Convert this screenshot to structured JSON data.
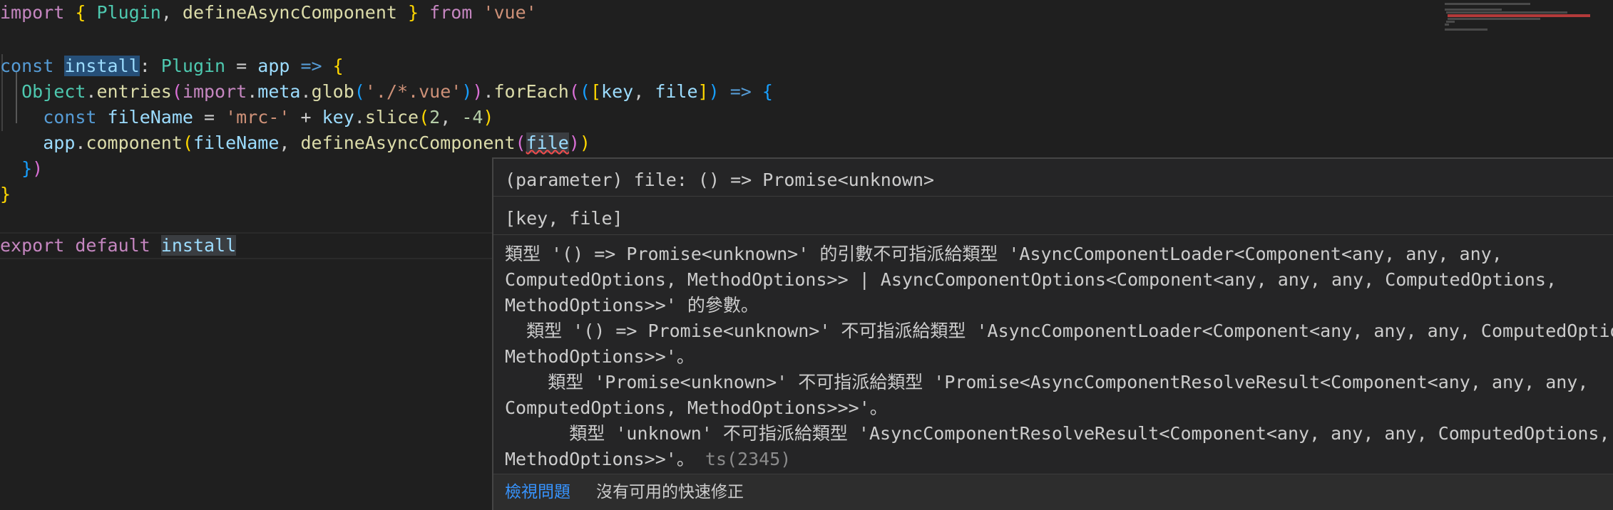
{
  "editor": {
    "lines": [
      "import { Plugin, defineAsyncComponent } from 'vue'",
      "",
      "const install: Plugin = app => {",
      "  Object.entries(import.meta.glob('./*.vue')).forEach(([key, file]) => {",
      "    const fileName = 'mrc-' + key.slice(2, -4)",
      "    app.component(fileName, defineAsyncComponent(file))",
      "  })",
      "}",
      "",
      "export default install"
    ]
  },
  "hover": {
    "signature": "(parameter) file: () => Promise<unknown>",
    "tuple": "[key, file]",
    "message_lines": [
      "類型 '() => Promise<unknown>' 的引數不可指派給類型 'AsyncComponentLoader<Component<any, any, any,",
      "ComputedOptions, MethodOptions>> | AsyncComponentOptions<Component<any, any, any, ComputedOptions,",
      "MethodOptions>>' 的參數。",
      "  類型 '() => Promise<unknown>' 不可指派給類型 'AsyncComponentLoader<Component<any, any, any, ComputedOptions,",
      "MethodOptions>>'。",
      "    類型 'Promise<unknown>' 不可指派給類型 'Promise<AsyncComponentResolveResult<Component<any, any, any,",
      "ComputedOptions, MethodOptions>>>'。",
      "      類型 'unknown' 不可指派給類型 'AsyncComponentResolveResult<Component<any, any, any, ComputedOptions,",
      "MethodOptions>>'。"
    ],
    "error_code": "ts(2345)",
    "view_problem_label": "檢視問題",
    "no_quick_fix_label": "沒有可用的快速修正"
  },
  "colors": {
    "background": "#1f1f1f",
    "hover_background": "#252526",
    "link": "#3794ff",
    "error_squiggle": "#f14c4c"
  }
}
